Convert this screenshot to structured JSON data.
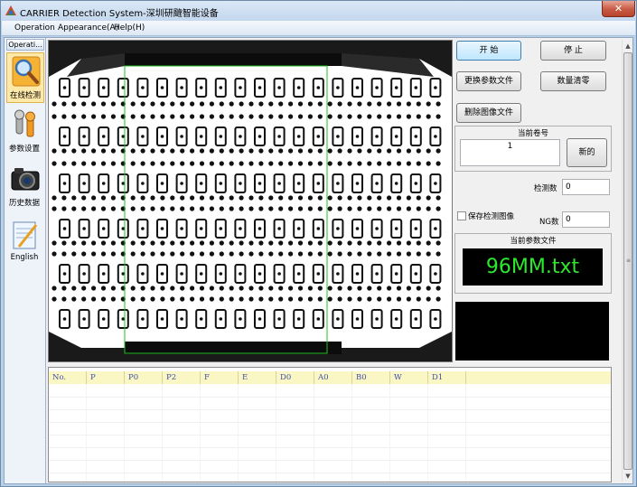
{
  "window": {
    "title": "CARRIER Detection System-深圳研颹智能设备",
    "close_label": "✕"
  },
  "menu": [
    {
      "label": "Operation"
    },
    {
      "label": "Appearance(A)"
    },
    {
      "label": "Help(H)"
    }
  ],
  "nav": {
    "header": "Operati...",
    "items": [
      {
        "label": "在线检测",
        "icon": "magnifier-icon",
        "active": true
      },
      {
        "label": "参数设置",
        "icon": "wrench-icon",
        "active": false
      },
      {
        "label": "历史数据",
        "icon": "camera-icon",
        "active": false
      },
      {
        "label": "English",
        "icon": "notepad-icon",
        "active": false
      }
    ]
  },
  "controls": {
    "start": "开 始",
    "stop": "停 止",
    "change_param_file": "更换参数文件",
    "reset_count": "数量清零",
    "delete_images": "删除图像文件",
    "roll_group_title": "当前卷号",
    "roll_value": "1",
    "new_roll": "新的",
    "detect_count_label": "检测数",
    "detect_count_value": "0",
    "save_images_label": "保存检测图像",
    "ng_count_label": "NG数",
    "ng_count_value": "0",
    "param_file_group_title": "当前参数文件",
    "param_file_value": "96MM.txt"
  },
  "colors": {
    "lcd_text": "#2ee82e",
    "table_header_bg": "#fbf7c5",
    "table_header_text": "#3c4ea8",
    "active_nav": "#ffe9a8"
  },
  "table": {
    "columns": [
      "No.",
      "P",
      "P0",
      "P2",
      "F",
      "E",
      "D0",
      "A0",
      "B0",
      "W",
      "D1"
    ],
    "rows": []
  }
}
